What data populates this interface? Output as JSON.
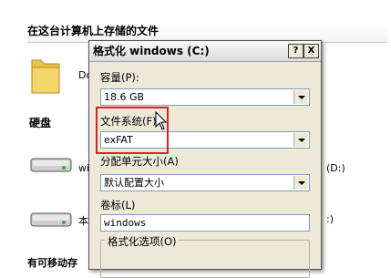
{
  "explorer": {
    "section_title": "在这台计算机上存储的文件",
    "folder_label": "Do",
    "drives_title": "硬盘",
    "drive1_label": "wi",
    "drive1_letter": "(D:)",
    "drive2_label": "本",
    "drive2_letter": ":)",
    "bottom_title": "有可移动存"
  },
  "dialog": {
    "title": "格式化 windows (C:)",
    "help_label": "?",
    "close_label": "X",
    "capacity_label": "容量(P):",
    "capacity_value": "18.6 GB",
    "filesystem_label": "文件系统(F)",
    "filesystem_value": "exFAT",
    "alloc_label": "分配单元大小(A)",
    "alloc_value": "默认配置大小",
    "volume_label": "卷标(L)",
    "volume_value": "windows",
    "options_label": "格式化选项(O)"
  },
  "colors": {
    "highlight": "#e02020",
    "dialog_bg": "#ece9d8",
    "field_border": "#7f9db9"
  }
}
